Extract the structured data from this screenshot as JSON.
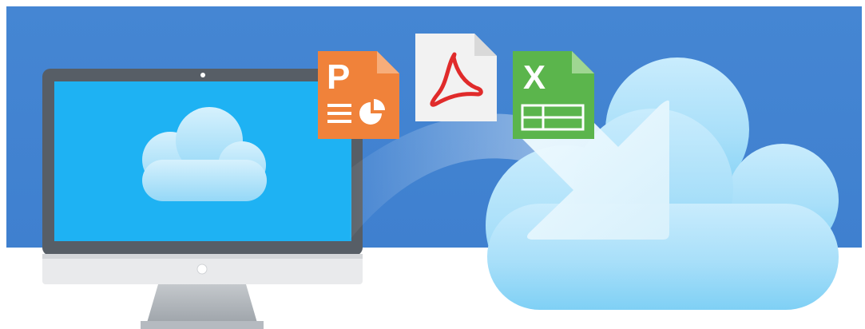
{
  "colors": {
    "banner": "#4286d4",
    "screen": "#1eb2f3",
    "powerpoint": "#f08438",
    "pdf": "#e02b2b",
    "excel": "#59b44b",
    "cloud": "#a8defa"
  },
  "icons": [
    "monitor-icon",
    "cloud-icon",
    "powerpoint-file-icon",
    "pdf-file-icon",
    "excel-file-icon",
    "arrow-icon"
  ],
  "files": {
    "powerpoint": {
      "letter": "P"
    },
    "excel": {
      "letter": "X"
    }
  }
}
